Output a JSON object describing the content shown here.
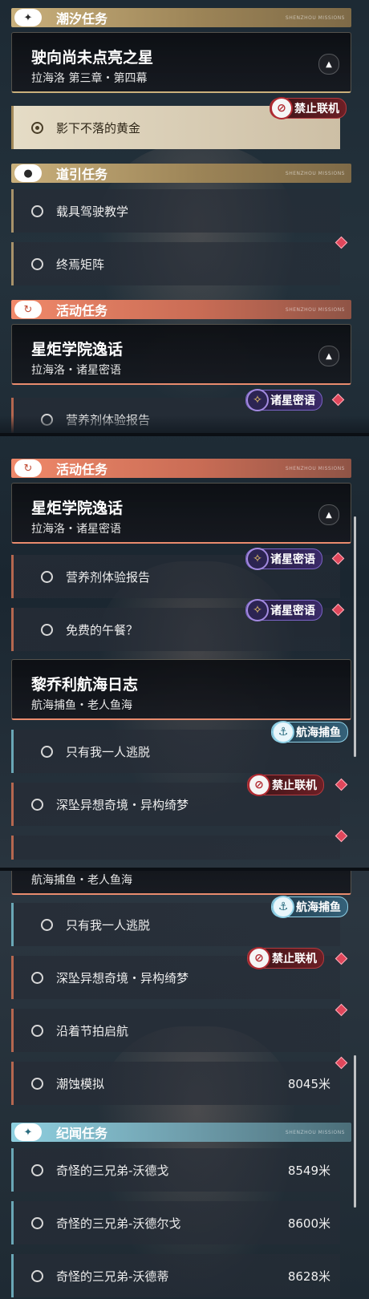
{
  "tiny_caption": "SHENZHOU MISSIONS",
  "sections": {
    "tide": "潮汐任务",
    "guide": "道引任务",
    "activity": "活动任务",
    "chronicle": "纪闻任务"
  },
  "cards": {
    "star": {
      "title": "驶向尚未点亮之星",
      "subtitle": "拉海洛 第三章・第四幕"
    },
    "academy": {
      "title": "星炬学院逸话",
      "subtitle": "拉海洛・诸星密语"
    },
    "voyage": {
      "title": "黎乔利航海日志",
      "subtitle": "航海捕鱼・老人鱼海"
    }
  },
  "tasks": {
    "shadow_gold": "影下不落的黄金",
    "vehicle": "载具驾驶教学",
    "matrix": "终焉矩阵",
    "nutrient_partial": "营养剂体验报告",
    "nutrient": "营养剂体验报告",
    "lunch": "免费的午餐？",
    "escape": "只有我一人逃脱",
    "fantasy": "深坠异想奇境・异构绮梦",
    "sail": "沿着节拍启航",
    "tide_sim": "潮蚀模拟",
    "brother1": "奇怪的三兄弟-沃德戈",
    "brother2": "奇怪的三兄弟-沃德尔戈",
    "brother3": "奇怪的三兄弟-沃德蒂"
  },
  "distances": {
    "tide_sim": "8045米",
    "brother1": "8549米",
    "brother2": "8600米",
    "brother3": "8628米"
  },
  "badges": {
    "no_online": "禁止联机",
    "star_whisper": "诸星密语",
    "fishing": "航海捕鱼"
  },
  "icons": {
    "tide": "sparkle-icon",
    "guide": "location-pin-icon",
    "activity": "refresh-icon",
    "chronicle": "sparkle-icon",
    "caret": "caret-up-icon",
    "ban": "no-multiplayer-icon",
    "star": "star-emblem-icon",
    "fish": "fishing-icon",
    "alert": "red-diamond-icon"
  },
  "colors": {
    "tide_header": "#c9b07c",
    "activity_header": "#f0896a",
    "chronicle_header": "#8fd0e0",
    "alert": "#e0475b"
  }
}
